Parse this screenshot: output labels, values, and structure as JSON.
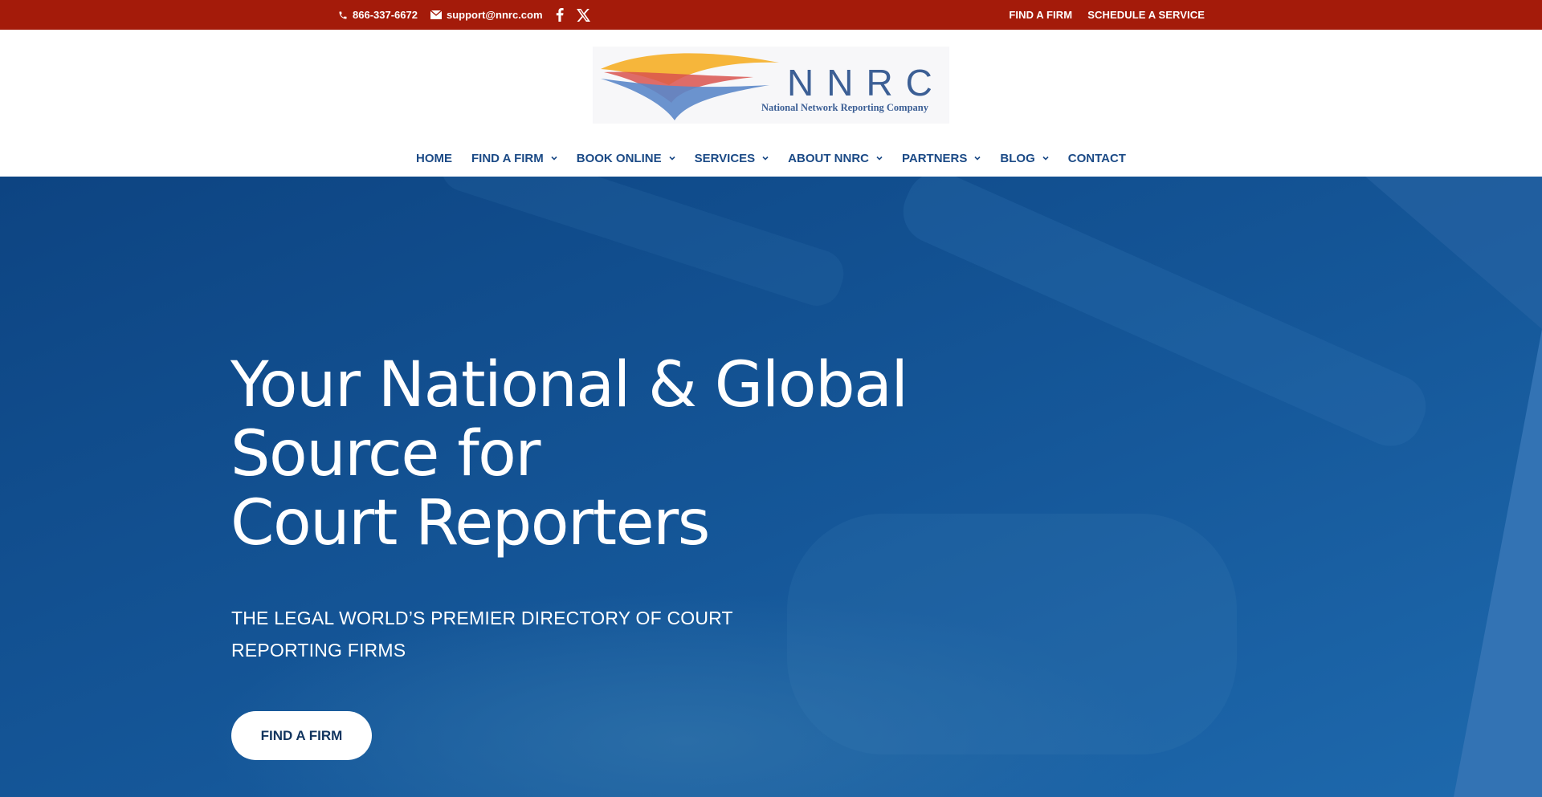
{
  "topbar": {
    "phone": "866-337-6672",
    "email": "support@nnrc.com",
    "links": [
      "FIND A FIRM",
      "SCHEDULE A SERVICE"
    ]
  },
  "logo": {
    "wordmark": "NNRC",
    "tagline": "National Network Reporting Company"
  },
  "nav": {
    "items": [
      {
        "label": "HOME",
        "dropdown": false
      },
      {
        "label": "FIND A FIRM",
        "dropdown": true
      },
      {
        "label": "BOOK ONLINE",
        "dropdown": true
      },
      {
        "label": "SERVICES",
        "dropdown": true
      },
      {
        "label": "ABOUT NNRC",
        "dropdown": true
      },
      {
        "label": "PARTNERS",
        "dropdown": true
      },
      {
        "label": "BLOG",
        "dropdown": true
      },
      {
        "label": "CONTACT",
        "dropdown": false
      }
    ]
  },
  "hero": {
    "title_line1": "Your National & Global Source for",
    "title_line2": "Court Reporters",
    "subtitle_line1": "THE LEGAL WORLD’S PREMIER DIRECTORY OF COURT",
    "subtitle_line2": "REPORTING FIRMS",
    "button_label": "FIND A FIRM"
  },
  "colors": {
    "topbar": "#a41b0a",
    "nav_text": "#1b4a86",
    "hero_blue": "#0f4d8a",
    "hero_stripe": "#3373b4"
  }
}
